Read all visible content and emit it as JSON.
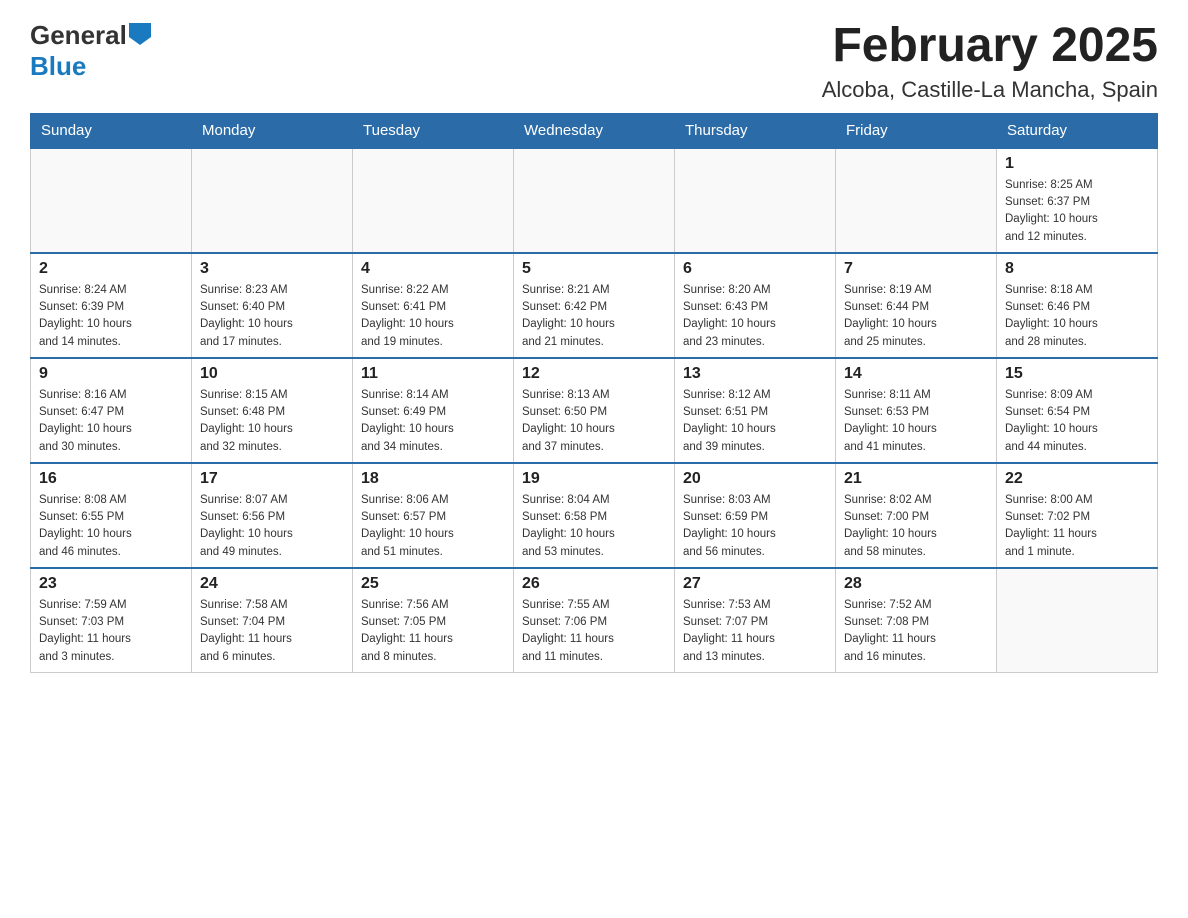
{
  "logo": {
    "text_general": "General",
    "text_blue": "Blue",
    "line2_text": ""
  },
  "header": {
    "month_title": "February 2025",
    "location": "Alcoba, Castille-La Mancha, Spain"
  },
  "weekdays": [
    "Sunday",
    "Monday",
    "Tuesday",
    "Wednesday",
    "Thursday",
    "Friday",
    "Saturday"
  ],
  "weeks": [
    [
      {
        "day": "",
        "info": ""
      },
      {
        "day": "",
        "info": ""
      },
      {
        "day": "",
        "info": ""
      },
      {
        "day": "",
        "info": ""
      },
      {
        "day": "",
        "info": ""
      },
      {
        "day": "",
        "info": ""
      },
      {
        "day": "1",
        "info": "Sunrise: 8:25 AM\nSunset: 6:37 PM\nDaylight: 10 hours\nand 12 minutes."
      }
    ],
    [
      {
        "day": "2",
        "info": "Sunrise: 8:24 AM\nSunset: 6:39 PM\nDaylight: 10 hours\nand 14 minutes."
      },
      {
        "day": "3",
        "info": "Sunrise: 8:23 AM\nSunset: 6:40 PM\nDaylight: 10 hours\nand 17 minutes."
      },
      {
        "day": "4",
        "info": "Sunrise: 8:22 AM\nSunset: 6:41 PM\nDaylight: 10 hours\nand 19 minutes."
      },
      {
        "day": "5",
        "info": "Sunrise: 8:21 AM\nSunset: 6:42 PM\nDaylight: 10 hours\nand 21 minutes."
      },
      {
        "day": "6",
        "info": "Sunrise: 8:20 AM\nSunset: 6:43 PM\nDaylight: 10 hours\nand 23 minutes."
      },
      {
        "day": "7",
        "info": "Sunrise: 8:19 AM\nSunset: 6:44 PM\nDaylight: 10 hours\nand 25 minutes."
      },
      {
        "day": "8",
        "info": "Sunrise: 8:18 AM\nSunset: 6:46 PM\nDaylight: 10 hours\nand 28 minutes."
      }
    ],
    [
      {
        "day": "9",
        "info": "Sunrise: 8:16 AM\nSunset: 6:47 PM\nDaylight: 10 hours\nand 30 minutes."
      },
      {
        "day": "10",
        "info": "Sunrise: 8:15 AM\nSunset: 6:48 PM\nDaylight: 10 hours\nand 32 minutes."
      },
      {
        "day": "11",
        "info": "Sunrise: 8:14 AM\nSunset: 6:49 PM\nDaylight: 10 hours\nand 34 minutes."
      },
      {
        "day": "12",
        "info": "Sunrise: 8:13 AM\nSunset: 6:50 PM\nDaylight: 10 hours\nand 37 minutes."
      },
      {
        "day": "13",
        "info": "Sunrise: 8:12 AM\nSunset: 6:51 PM\nDaylight: 10 hours\nand 39 minutes."
      },
      {
        "day": "14",
        "info": "Sunrise: 8:11 AM\nSunset: 6:53 PM\nDaylight: 10 hours\nand 41 minutes."
      },
      {
        "day": "15",
        "info": "Sunrise: 8:09 AM\nSunset: 6:54 PM\nDaylight: 10 hours\nand 44 minutes."
      }
    ],
    [
      {
        "day": "16",
        "info": "Sunrise: 8:08 AM\nSunset: 6:55 PM\nDaylight: 10 hours\nand 46 minutes."
      },
      {
        "day": "17",
        "info": "Sunrise: 8:07 AM\nSunset: 6:56 PM\nDaylight: 10 hours\nand 49 minutes."
      },
      {
        "day": "18",
        "info": "Sunrise: 8:06 AM\nSunset: 6:57 PM\nDaylight: 10 hours\nand 51 minutes."
      },
      {
        "day": "19",
        "info": "Sunrise: 8:04 AM\nSunset: 6:58 PM\nDaylight: 10 hours\nand 53 minutes."
      },
      {
        "day": "20",
        "info": "Sunrise: 8:03 AM\nSunset: 6:59 PM\nDaylight: 10 hours\nand 56 minutes."
      },
      {
        "day": "21",
        "info": "Sunrise: 8:02 AM\nSunset: 7:00 PM\nDaylight: 10 hours\nand 58 minutes."
      },
      {
        "day": "22",
        "info": "Sunrise: 8:00 AM\nSunset: 7:02 PM\nDaylight: 11 hours\nand 1 minute."
      }
    ],
    [
      {
        "day": "23",
        "info": "Sunrise: 7:59 AM\nSunset: 7:03 PM\nDaylight: 11 hours\nand 3 minutes."
      },
      {
        "day": "24",
        "info": "Sunrise: 7:58 AM\nSunset: 7:04 PM\nDaylight: 11 hours\nand 6 minutes."
      },
      {
        "day": "25",
        "info": "Sunrise: 7:56 AM\nSunset: 7:05 PM\nDaylight: 11 hours\nand 8 minutes."
      },
      {
        "day": "26",
        "info": "Sunrise: 7:55 AM\nSunset: 7:06 PM\nDaylight: 11 hours\nand 11 minutes."
      },
      {
        "day": "27",
        "info": "Sunrise: 7:53 AM\nSunset: 7:07 PM\nDaylight: 11 hours\nand 13 minutes."
      },
      {
        "day": "28",
        "info": "Sunrise: 7:52 AM\nSunset: 7:08 PM\nDaylight: 11 hours\nand 16 minutes."
      },
      {
        "day": "",
        "info": ""
      }
    ]
  ]
}
